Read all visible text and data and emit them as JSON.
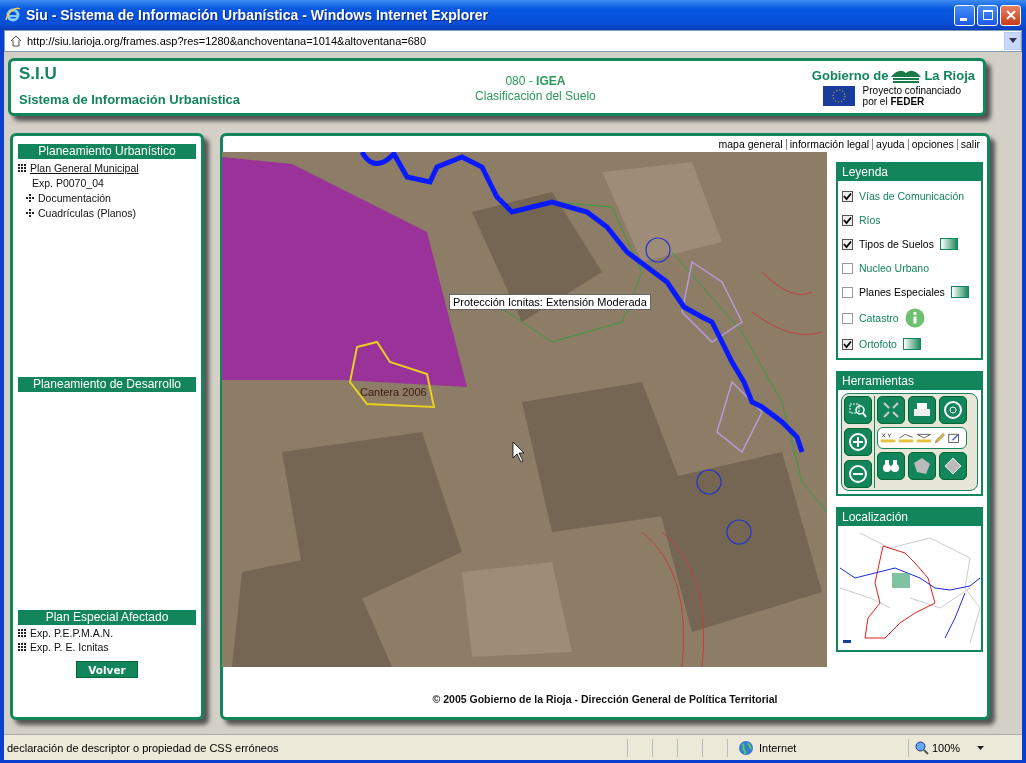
{
  "window": {
    "title": "Siu - Sistema de Información Urbanística - Windows Internet Explorer",
    "address": "http://siu.larioja.org/frames.asp?res=1280&anchoventana=1014&altoventana=680"
  },
  "header": {
    "acronym": "S.I.U",
    "name": "Sistema de Información Urbanística",
    "code": "080 - **IGEA**",
    "subtitle": "Clasificación del Suelo",
    "logo_left": "Gobierno de",
    "logo_right": "La Rioja",
    "cofinance": [
      "Proyecto cofinanciado",
      "por el **FEDER**"
    ]
  },
  "sidebar": {
    "sections": [
      {
        "title": "Planeamiento Urbanístico",
        "items": [
          {
            "label": "Plan General Municipal",
            "kind": "link",
            "children": [
              {
                "label": "Exp. P0070_04",
                "kind": "plain"
              },
              {
                "label": "Documentación",
                "kind": "folder"
              },
              {
                "label": "Cuadrículas (Planos)",
                "kind": "folder"
              }
            ]
          }
        ]
      },
      {
        "title": "Planeamiento de Desarrollo"
      },
      {
        "title": "Plan Especial Afectado",
        "items": [
          {
            "label": "Exp. P.E.P.M.A.N.",
            "kind": "grid"
          },
          {
            "label": "Exp. P. E. Icnitas",
            "kind": "grid"
          }
        ]
      }
    ],
    "button": "Volver"
  },
  "map_links": [
    "mapa general",
    "información legal",
    "ayuda",
    "opciones",
    "salir"
  ],
  "map": {
    "tooltip": "Protección Icnitas: Extensión Moderada",
    "feature_label": "Cantera 2006"
  },
  "legend": {
    "title": "Leyenda",
    "items": [
      {
        "label": "Vías de Comunicación",
        "checked": true,
        "link": true,
        "kind": "plain"
      },
      {
        "label": "Ríos",
        "checked": true,
        "link": true,
        "kind": "plain"
      },
      {
        "label": "Tipos de Suelos",
        "checked": true,
        "link": false,
        "kind": "swatch"
      },
      {
        "label": "Nucleo Urbano",
        "checked": false,
        "link": true,
        "kind": "plain"
      },
      {
        "label": "Planes Especiales",
        "checked": false,
        "link": false,
        "kind": "swatch"
      },
      {
        "label": "Catastro",
        "checked": false,
        "link": true,
        "kind": "info"
      },
      {
        "label": "Ortofoto",
        "checked": true,
        "link": true,
        "kind": "swatch"
      }
    ]
  },
  "tools": {
    "title": "Herramientas"
  },
  "location": {
    "title": "Localización"
  },
  "footer": "© 2005 Gobierno de la Rioja - Dirección General de Política Territorial",
  "status_bar": {
    "message": "declaración de descriptor o propiedad de CSS erróneos",
    "zone": "Internet",
    "zoom": "100%"
  }
}
